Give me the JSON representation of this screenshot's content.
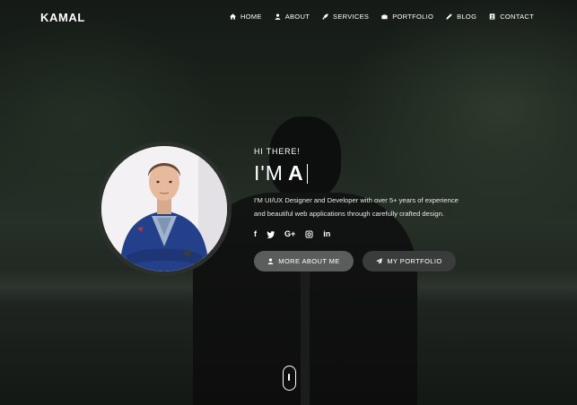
{
  "brand": "KAMAL",
  "nav": {
    "items": [
      {
        "label": "HOME",
        "icon": "home-icon"
      },
      {
        "label": "ABOUT",
        "icon": "user-icon"
      },
      {
        "label": "SERVICES",
        "icon": "rocket-icon"
      },
      {
        "label": "PORTFOLIO",
        "icon": "briefcase-icon"
      },
      {
        "label": "BLOG",
        "icon": "pencil-icon"
      },
      {
        "label": "CONTACT",
        "icon": "contact-card-icon"
      }
    ]
  },
  "hero": {
    "greeting": "HI THERE!",
    "headline_prefix": "I'M",
    "headline_typed": "A",
    "bio_line1": "I'M UI/UX Designer and Developer with over 5+ years of experience",
    "bio_line2": "and beautiful web applications through carefully crafted design.",
    "socials": [
      {
        "label": "f",
        "icon": "facebook-icon"
      },
      {
        "label": "",
        "icon": "twitter-icon"
      },
      {
        "label": "G+",
        "icon": "google-plus-icon"
      },
      {
        "label": "",
        "icon": "instagram-icon"
      },
      {
        "label": "in",
        "icon": "linkedin-icon"
      }
    ],
    "buttons": {
      "about_label": "MORE ABOUT ME",
      "portfolio_label": "MY PORTFOLIO"
    }
  },
  "colors": {
    "button_primary": "#5b5d5c",
    "button_secondary": "#3a3c3b",
    "avatar_ring": "#2b302d"
  }
}
